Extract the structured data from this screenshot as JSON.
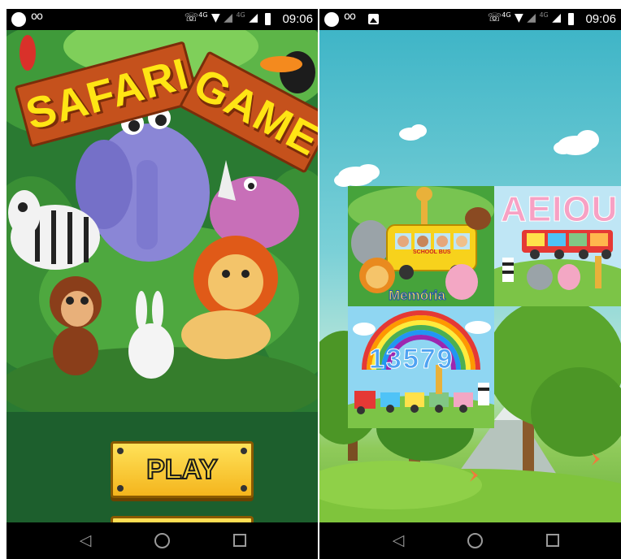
{
  "status_bar": {
    "time": "09:06",
    "network_tag": "4G",
    "network_tag_2": "4G",
    "icons": [
      "voicemail-icon",
      "call-volte-icon",
      "wifi-icon",
      "signal-icon",
      "battery-icon"
    ]
  },
  "left_screen": {
    "title_word_1": "SAFARI",
    "title_word_2": "GAME",
    "play_label": "PLAY"
  },
  "right_screen": {
    "tiles": [
      {
        "label": "Memória"
      },
      {
        "label": "AEIOU"
      },
      {
        "label": "13579"
      }
    ],
    "school_bus_text": "SCHOOL BUS"
  },
  "nav_bar": {
    "back": "◁",
    "home": "home",
    "recent": "recent"
  },
  "colors": {
    "title_board": "#c5511c",
    "title_text": "#ffe514",
    "play_button": "#f4b51d",
    "jungle_bg": "#1d5f2d",
    "sky": "#3fb5c7"
  }
}
